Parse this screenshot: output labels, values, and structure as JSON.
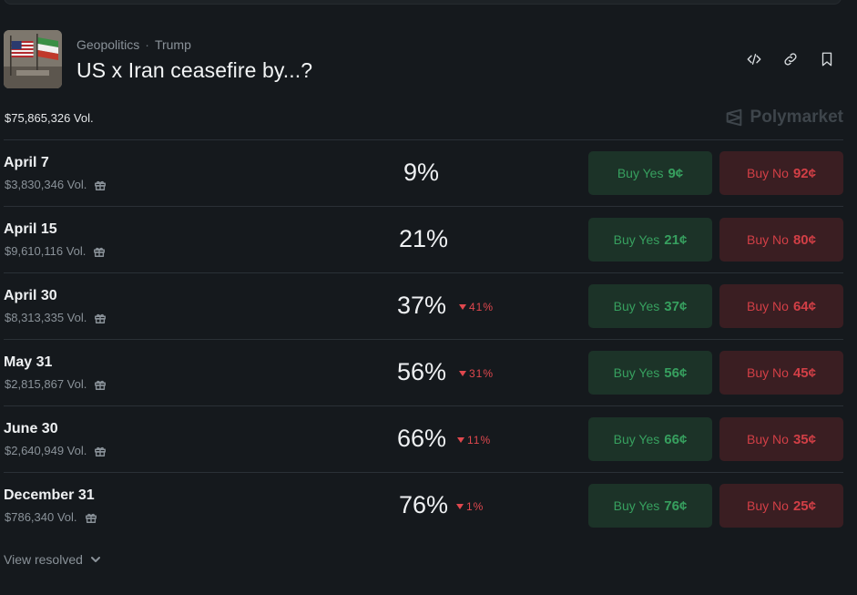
{
  "market": {
    "category": "Geopolitics",
    "subcategory": "Trump",
    "title": "US x Iran ceasefire by...?",
    "total_volume": "$75,865,326 Vol.",
    "brand": "Polymarket"
  },
  "outcomes": [
    {
      "date": "April 7",
      "volume": "$3,830,346 Vol.",
      "pct": "9%",
      "change": "",
      "yes_label": "Buy Yes",
      "yes_price": "9¢",
      "no_label": "Buy No",
      "no_price": "92¢"
    },
    {
      "date": "April 15",
      "volume": "$9,610,116 Vol.",
      "pct": "21%",
      "change": "",
      "yes_label": "Buy Yes",
      "yes_price": "21¢",
      "no_label": "Buy No",
      "no_price": "80¢"
    },
    {
      "date": "April 30",
      "volume": "$8,313,335 Vol.",
      "pct": "37%",
      "change": "41%",
      "yes_label": "Buy Yes",
      "yes_price": "37¢",
      "no_label": "Buy No",
      "no_price": "64¢"
    },
    {
      "date": "May 31",
      "volume": "$2,815,867 Vol.",
      "pct": "56%",
      "change": "31%",
      "yes_label": "Buy Yes",
      "yes_price": "56¢",
      "no_label": "Buy No",
      "no_price": "45¢"
    },
    {
      "date": "June 30",
      "volume": "$2,640,949 Vol.",
      "pct": "66%",
      "change": "11%",
      "yes_label": "Buy Yes",
      "yes_price": "66¢",
      "no_label": "Buy No",
      "no_price": "35¢"
    },
    {
      "date": "December 31",
      "volume": "$786,340 Vol.",
      "pct": "76%",
      "change": "1%",
      "yes_label": "Buy Yes",
      "yes_price": "76¢",
      "no_label": "Buy No",
      "no_price": "25¢"
    }
  ],
  "footer": {
    "view_resolved": "View resolved"
  },
  "icons": {
    "header_actions": [
      "embed-code-icon",
      "link-icon",
      "bookmark-icon"
    ],
    "row_volume": "gift-icon",
    "change_direction": "down-triangle-icon",
    "expand": "chevron-down-icon"
  },
  "colors": {
    "background": "#15191d",
    "yes_bg": "#1c3328",
    "yes_text": "#37a05f",
    "no_bg": "#3a1e22",
    "no_text": "#d23f46",
    "change_down": "#e0484e"
  }
}
